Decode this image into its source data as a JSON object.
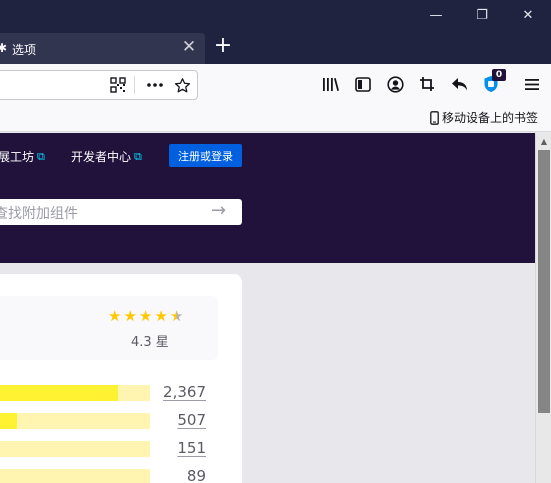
{
  "window": {
    "min_glyph": "—",
    "max_glyph": "❐",
    "close_glyph": "✕"
  },
  "tab": {
    "title": "选项",
    "favicon": "puzzle-piece-icon",
    "close_glyph": "✕"
  },
  "newtab_glyph": "+",
  "toolbar": {
    "badge": "0",
    "colors": {
      "badge_bg": "#20123a",
      "extension_icon": "#0090ed"
    }
  },
  "bookmarks": {
    "mobile_bookmarks": "移动设备上的书签"
  },
  "header": {
    "links": [
      {
        "label": "扩展工坊"
      },
      {
        "label": "开发者中心"
      }
    ],
    "login_button": "注册或登录",
    "search_placeholder": "查找附加组件",
    "colors": {
      "band": "#20123a",
      "login": "#0060df",
      "ext_link_icon": "#00ddff"
    }
  },
  "rating": {
    "average_label": "4.3 星",
    "average": 4.3,
    "distribution": [
      {
        "count": "2,367",
        "fraction": 0.8
      },
      {
        "count": "507",
        "fraction": 0.17
      },
      {
        "count": "151",
        "fraction": 0.05
      },
      {
        "count": "89",
        "fraction": 0.03
      }
    ],
    "colors": {
      "fill": "#fff233",
      "track": "#fff4b0",
      "star": "#ffc800"
    }
  }
}
